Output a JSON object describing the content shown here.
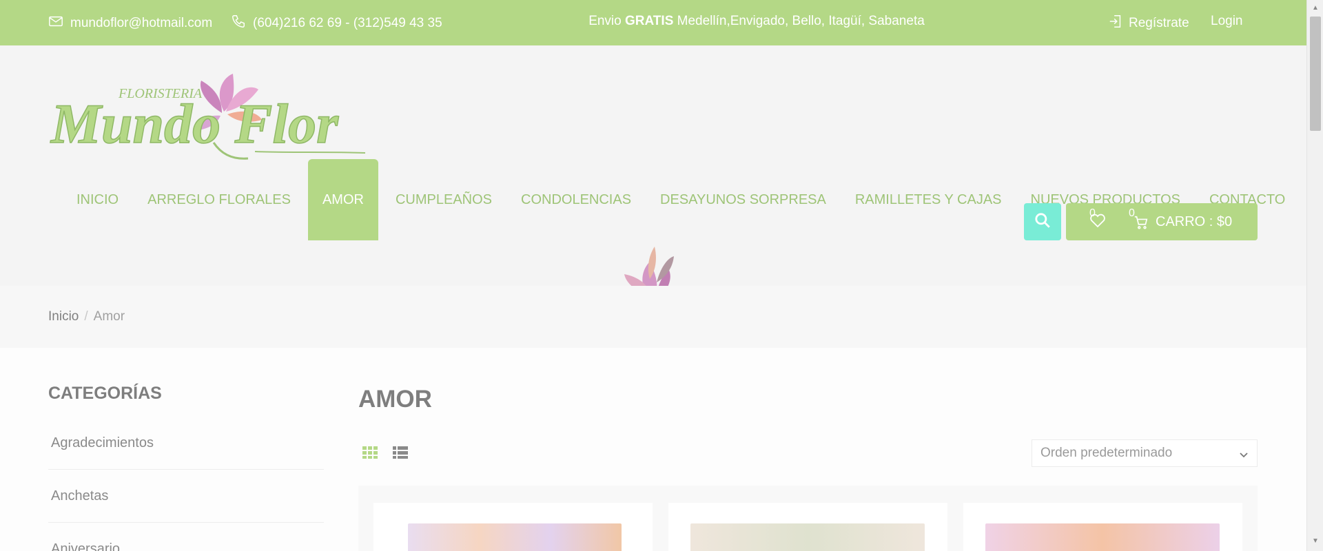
{
  "topbar": {
    "email": "mundoflor@hotmail.com",
    "phone": "(604)216 62 69 - (312)549 43 35",
    "promo_prefix": "Envio ",
    "promo_bold": "GRATIS",
    "promo_suffix": " Medellín,Envigado, Bello, Itagüí, Sabaneta",
    "register": "Regístrate",
    "login": "Login"
  },
  "logo": {
    "small_text": "FLORISTERIA",
    "main_text": "Mundo Flor"
  },
  "nav": {
    "items": [
      {
        "label": "INICIO"
      },
      {
        "label": "ARREGLO FLORALES"
      },
      {
        "label": "AMOR"
      },
      {
        "label": "CUMPLEAÑOS"
      },
      {
        "label": "CONDOLENCIAS"
      },
      {
        "label": "DESAYUNOS SORPRESA"
      },
      {
        "label": "RAMILLETES Y CAJAS"
      },
      {
        "label": "NUEVOS PRODUCTOS"
      },
      {
        "label": "CONTACTO"
      }
    ],
    "active": "AMOR"
  },
  "cart": {
    "wishlist_count": "0",
    "cart_count": "0",
    "label": "CARRO : $0"
  },
  "breadcrumb": {
    "home": "Inicio",
    "separator": "/",
    "current": "Amor"
  },
  "sidebar": {
    "title": "CATEGORÍAS",
    "items": [
      {
        "label": "Agradecimientos"
      },
      {
        "label": "Anchetas"
      },
      {
        "label": "Aniversario"
      }
    ]
  },
  "main": {
    "title": "AMOR",
    "sort": {
      "selected": "Orden predeterminado"
    }
  },
  "colors": {
    "brand_green": "#b4d886",
    "accent_teal": "#79ecd6",
    "nav_text": "#9ec477"
  }
}
